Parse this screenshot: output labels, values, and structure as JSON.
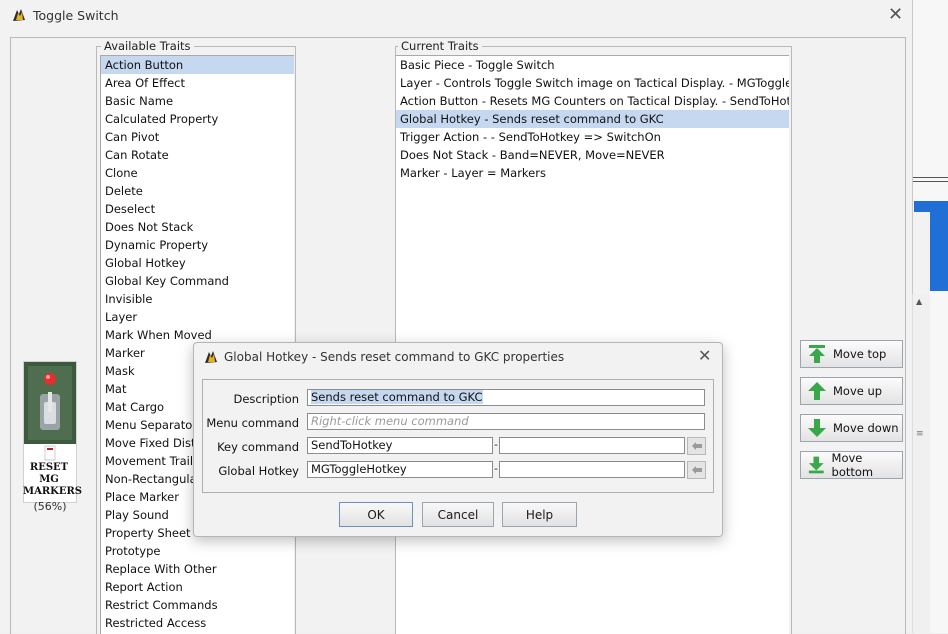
{
  "window": {
    "title": "Toggle Switch"
  },
  "piece": {
    "label_lines": [
      "RESET",
      "MG",
      "MARKERS"
    ],
    "zoom": "(56%)"
  },
  "available": {
    "title": "Available Traits",
    "items": [
      "Action Button",
      "Area Of Effect",
      "Basic Name",
      "Calculated Property",
      "Can Pivot",
      "Can Rotate",
      "Clone",
      "Delete",
      "Deselect",
      "Does Not Stack",
      "Dynamic Property",
      "Global Hotkey",
      "Global Key Command",
      "Invisible",
      "Layer",
      "Mark When Moved",
      "Marker",
      "Mask",
      "Mat",
      "Mat Cargo",
      "Menu Separator",
      "Move Fixed Distance",
      "Movement Trail",
      "Non-Rectangular",
      "Place Marker",
      "Play Sound",
      "Property Sheet",
      "Prototype",
      "Replace With Other",
      "Report Action",
      "Restrict Commands",
      "Restricted Access"
    ],
    "selected_index": 0
  },
  "current": {
    "title": "Current Traits",
    "items": [
      "Basic Piece - Toggle Switch",
      "Layer - Controls Toggle Switch image on Tactical Display. - MGToggleSwitch",
      "Action Button - Resets MG Counters on Tactical Display. - SendToHotkey",
      "Global Hotkey - Sends reset command to GKC",
      "Trigger Action -  - SendToHotkey => SwitchOn",
      "Does Not Stack - Band=NEVER, Move=NEVER",
      "Marker - Layer = Markers"
    ],
    "selected_index": 3
  },
  "move_buttons": {
    "top": "Move top",
    "up": "Move up",
    "down": "Move down",
    "bottom": "Move bottom"
  },
  "dialog": {
    "title": "Global Hotkey - Sends reset command to GKC properties",
    "description_label": "Description",
    "description_value": "Sends reset command to GKC",
    "menu_label": "Menu command",
    "menu_placeholder": "Right-click menu command",
    "key_label": "Key command",
    "key_value": "SendToHotkey",
    "hotkey_label": "Global Hotkey",
    "hotkey_value": "MGToggleHotkey",
    "separator": "-",
    "ok": "OK",
    "cancel": "Cancel",
    "help": "Help"
  },
  "colors": {
    "selection": "#c6d8f0",
    "arrow_green": "#3aa84a"
  }
}
